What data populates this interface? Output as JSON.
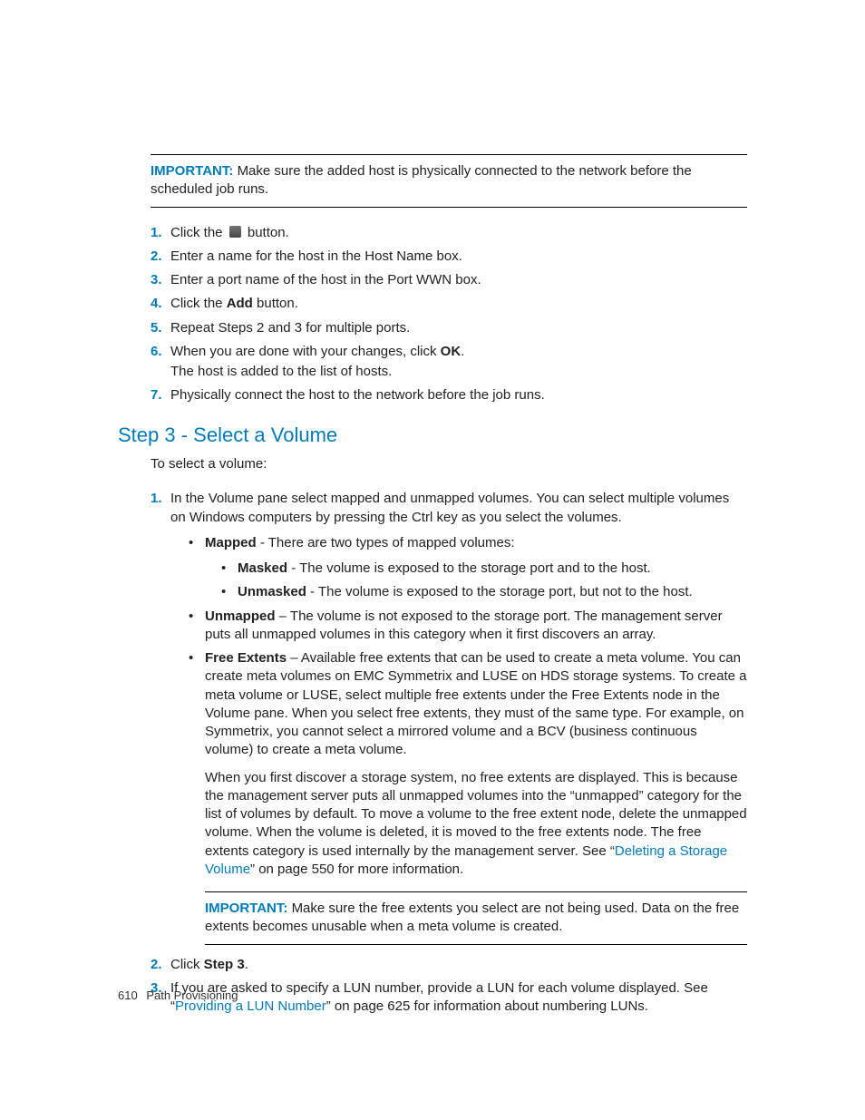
{
  "callout1": {
    "lead": "IMPORTANT:",
    "text": "Make sure the added host is physically connected to the network before the scheduled job runs."
  },
  "steps1": {
    "s1_pre": "Click the ",
    "s1_post": " button.",
    "s2": "Enter a name for the host in the Host Name box.",
    "s3": "Enter a port name of the host in the Port WWN box.",
    "s4_pre": "Click the ",
    "s4_bold": "Add",
    "s4_post": " button.",
    "s5": "Repeat Steps 2 and 3 for multiple ports.",
    "s6_pre": "When you are done with your changes, click ",
    "s6_bold": "OK",
    "s6_post": ".",
    "s6_sub": "The host is added to the list of hosts.",
    "s7": "Physically connect the host to the network before the job runs."
  },
  "heading": "Step 3 - Select a Volume",
  "intro": "To select a volume:",
  "vol": {
    "s1": "In the Volume pane select mapped and unmapped volumes. You can select multiple volumes on Windows computers by pressing the Ctrl key as you select the volumes.",
    "mapped_label": "Mapped",
    "mapped_text": " - There are two types of mapped volumes:",
    "masked_label": "Masked",
    "masked_text": " - The volume is exposed to the storage port and to the host.",
    "unmasked_label": "Unmasked",
    "unmasked_text": " - The volume is exposed to the storage port, but not to the host.",
    "unmapped_label": "Unmapped",
    "unmapped_text": " – The volume is not exposed to the storage port. The management server puts all unmapped volumes in this category when it first discovers an array.",
    "free_label": "Free Extents",
    "free_text": " – Available free extents that can be used to create a meta volume. You can create meta volumes on EMC Symmetrix and LUSE on HDS storage systems. To create a meta volume or LUSE, select multiple free extents under the Free Extents node in the Volume pane. When you select free extents, they must of the same type. For example, on Symmetrix, you cannot select a mirrored volume and a BCV (business continuous volume) to create a meta volume.",
    "free_p2_pre": "When you first discover a storage system, no free extents are displayed. This is because the management server puts all unmapped volumes into the “unmapped” category for the list of volumes by default. To move a volume to the free extent node, delete the unmapped volume. When the volume is deleted, it is moved to the free extents node. The free extents category is used internally by the management server. See “",
    "free_p2_link": "Deleting a Storage Volume",
    "free_p2_post": "” on page 550 for more information.",
    "callout_lead": "IMPORTANT:",
    "callout_text": "Make sure the free extents you select are not being used. Data on the free extents becomes unusable when a meta volume is created.",
    "s2_pre": "Click ",
    "s2_bold": "Step 3",
    "s2_post": ".",
    "s3_pre": "If you are asked to specify a LUN number, provide a LUN for each volume displayed. See “",
    "s3_link": "Providing a LUN Number",
    "s3_post": "” on page 625 for information about numbering LUNs."
  },
  "footer": {
    "page": "610",
    "title": "Path Provisioning"
  }
}
